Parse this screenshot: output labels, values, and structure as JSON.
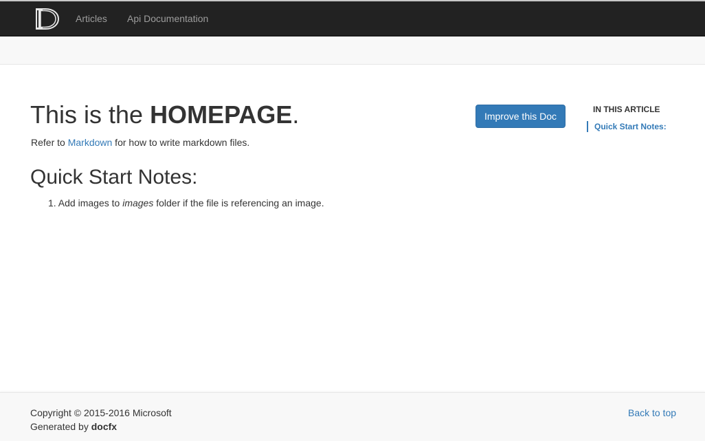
{
  "navbar": {
    "logo_label": "docfx-logo",
    "items": [
      {
        "label": "Articles"
      },
      {
        "label": "Api Documentation"
      }
    ]
  },
  "article": {
    "title_prefix": "This is the ",
    "title_bold": "HOMEPAGE",
    "title_suffix": ".",
    "refer_prefix": "Refer to ",
    "refer_link": "Markdown",
    "refer_suffix": " for how to write markdown files.",
    "section_heading": "Quick Start Notes:",
    "list": [
      {
        "number": "1.",
        "text_before": " Add images to ",
        "emphasis": "images",
        "text_after": " folder if the file is referencing an image."
      }
    ]
  },
  "toolbar": {
    "improve_label": "Improve this Doc"
  },
  "toc": {
    "title": "IN THIS ARTICLE",
    "items": [
      {
        "label": "Quick Start Notes:"
      }
    ]
  },
  "footer": {
    "copyright": "Copyright © 2015-2016 Microsoft",
    "generated_prefix": "Generated by ",
    "generated_by": "docfx",
    "back_to_top": "Back to top"
  },
  "colors": {
    "navbar_bg": "#222222",
    "nav_link": "#9d9d9d",
    "accent": "#337ab7",
    "subnav_bg": "#f8f8f8",
    "footer_bg": "#f8f8f8"
  }
}
